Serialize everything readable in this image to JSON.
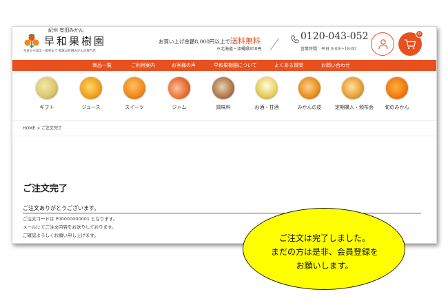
{
  "header": {
    "region": "紀州 有田みかん",
    "brand": "早和果樹園",
    "tagline": "生産から加工・販売まで 和歌山有田みかんの専門店",
    "shipping_text": "お買い上げ金額8,000円以上で",
    "shipping_highlight": "送料無料",
    "shipping_note": "※北海道・沖縄県850円",
    "phone": "0120-043-052",
    "hours": "営業時間：平日 9:00～18:00",
    "cart_count": "0",
    "icons": {
      "logo": "mikan-logo-icon",
      "phone": "phone-icon",
      "account": "user-icon",
      "cart": "cart-icon"
    }
  },
  "nav": {
    "items": [
      {
        "label": "商品一覧"
      },
      {
        "label": "ご利用案内"
      },
      {
        "label": "お客様の声"
      },
      {
        "label": "早和果樹園について"
      },
      {
        "label": "よくある質問"
      },
      {
        "label": "お問い合わせ"
      }
    ]
  },
  "categories": [
    {
      "label": "ギフト",
      "color": "#d9c36a"
    },
    {
      "label": "ジュース",
      "color": "#f0a020"
    },
    {
      "label": "スイーツ",
      "color": "#f08a1a"
    },
    {
      "label": "ジャム",
      "color": "#e87030"
    },
    {
      "label": "調味料",
      "color": "#b07850"
    },
    {
      "label": "お酒・甘酒",
      "color": "#e8d060"
    },
    {
      "label": "みかんの皮",
      "color": "#e8901c"
    },
    {
      "label": "定期購入・頒布会",
      "color": "#e8a030"
    },
    {
      "label": "旬のみかん",
      "color": "#f07a10"
    }
  ],
  "breadcrumb": "HOME > ご注文完了",
  "main": {
    "title": "ご注文完了",
    "thanks": "ご注文ありがとうございます。",
    "lines": [
      "ご注文コードは P00000000001 となります。",
      "メールにてご注文内容をお送りしております。",
      "ご確認よろしくお願い申し上げます。"
    ]
  },
  "callout": {
    "lines": [
      "ご注文は完了しました。",
      "まだの方は是非、会員登録を",
      "お願いします。"
    ]
  },
  "colors": {
    "accent": "#e8501f",
    "callout": "#ffff00"
  }
}
